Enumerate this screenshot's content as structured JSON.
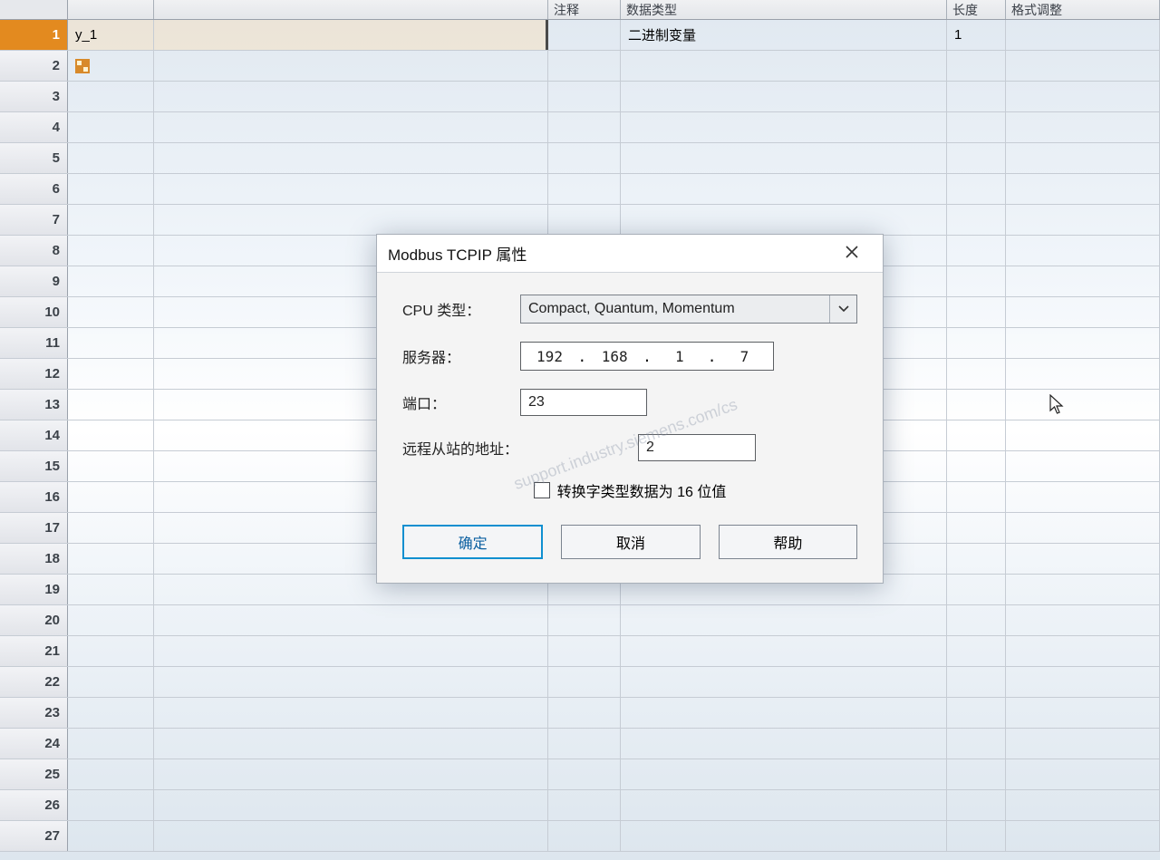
{
  "table": {
    "headers": {
      "note": "注释",
      "dtype": "数据类型",
      "len": "长度",
      "fmt": "格式调整"
    },
    "rows": [
      {
        "num": "1",
        "name": "y_1",
        "dtype": "二进制变量",
        "len": "1",
        "selected": true
      },
      {
        "num": "2",
        "has_icon": true
      },
      {
        "num": "3"
      },
      {
        "num": "4"
      },
      {
        "num": "5"
      },
      {
        "num": "6"
      },
      {
        "num": "7"
      },
      {
        "num": "8"
      },
      {
        "num": "9"
      },
      {
        "num": "10"
      },
      {
        "num": "11"
      },
      {
        "num": "12"
      },
      {
        "num": "13"
      },
      {
        "num": "14"
      },
      {
        "num": "15"
      },
      {
        "num": "16"
      },
      {
        "num": "17"
      },
      {
        "num": "18"
      },
      {
        "num": "19"
      },
      {
        "num": "20"
      },
      {
        "num": "21"
      },
      {
        "num": "22"
      },
      {
        "num": "23"
      },
      {
        "num": "24"
      },
      {
        "num": "25"
      },
      {
        "num": "26"
      },
      {
        "num": "27"
      }
    ]
  },
  "dialog": {
    "title": "Modbus TCPIP 属性",
    "cpu_label": "CPU 类型：",
    "cpu_value": "Compact, Quantum, Momentum",
    "server_label": "服务器：",
    "ip": {
      "o1": "192",
      "o2": "168",
      "o3": "1",
      "o4": "7"
    },
    "port_label": "端口：",
    "port_value": "23",
    "remote_label": "远程从站的地址：",
    "remote_value": "2",
    "convert_label": "转换字类型数据为 16 位值",
    "ok": "确定",
    "cancel": "取消",
    "help": "帮助"
  },
  "watermark": "support.industry.siemens.com/cs"
}
